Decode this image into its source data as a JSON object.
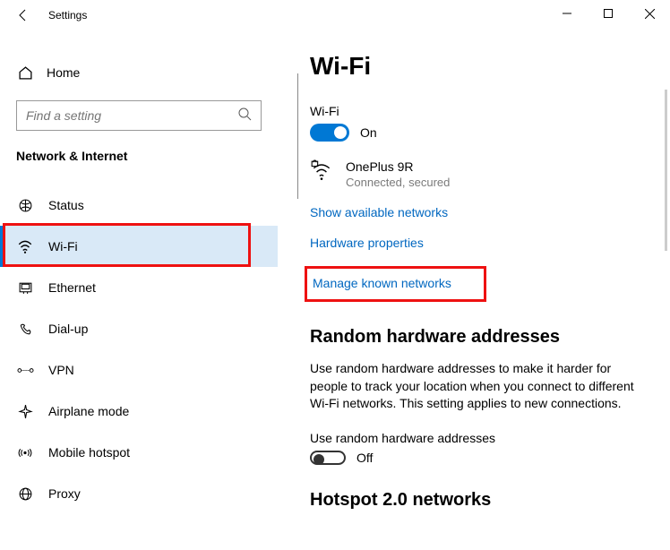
{
  "app": {
    "title": "Settings"
  },
  "sidebar": {
    "home": "Home",
    "search_placeholder": "Find a setting",
    "section": "Network & Internet",
    "items": [
      {
        "label": "Status"
      },
      {
        "label": "Wi-Fi"
      },
      {
        "label": "Ethernet"
      },
      {
        "label": "Dial-up"
      },
      {
        "label": "VPN"
      },
      {
        "label": "Airplane mode"
      },
      {
        "label": "Mobile hotspot"
      },
      {
        "label": "Proxy"
      }
    ]
  },
  "main": {
    "title": "Wi-Fi",
    "wifi_label": "Wi-Fi",
    "wifi_toggle_state": "On",
    "network": {
      "name": "OnePlus 9R",
      "status": "Connected, secured"
    },
    "links": {
      "available": "Show available networks",
      "hardware": "Hardware properties",
      "manage": "Manage known networks"
    },
    "random": {
      "heading": "Random hardware addresses",
      "body": "Use random hardware addresses to make it harder for people to track your location when you connect to different Wi-Fi networks. This setting applies to new connections.",
      "toggle_label": "Use random hardware addresses",
      "toggle_state": "Off"
    },
    "hotspot_heading": "Hotspot 2.0 networks"
  }
}
